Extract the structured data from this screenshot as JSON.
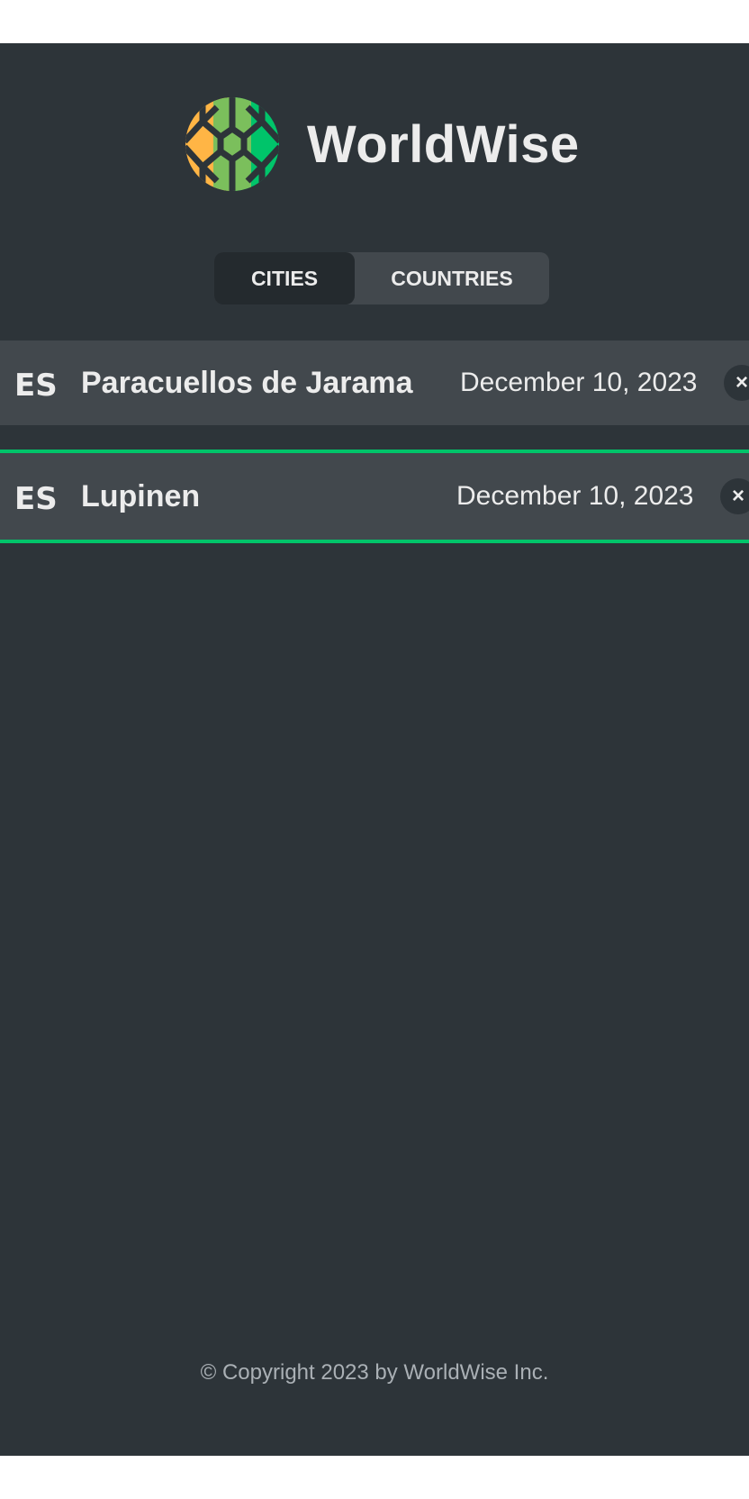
{
  "app": {
    "brand": "WorldWise",
    "tabs": [
      {
        "label": "CITIES",
        "active": true
      },
      {
        "label": "COUNTRIES",
        "active": false
      }
    ],
    "cities": [
      {
        "country_code": "ES",
        "name": "Paracuellos de Jarama",
        "date": "December 10, 2023",
        "delete_label": "×"
      },
      {
        "country_code": "ES",
        "name": "Lupinen",
        "date": "December 10, 2023",
        "delete_label": "×"
      }
    ],
    "footer": "© Copyright 2023 by WorldWise Inc."
  },
  "colors": {
    "background": "#2d3439",
    "panel": "#42484d",
    "active_tab": "#242a2e",
    "accent_green": "#00c46a",
    "logo_orange": "#ffb545",
    "logo_light_green": "#7bbf5c",
    "text": "#ececec",
    "muted_text": "#aab0b5"
  }
}
